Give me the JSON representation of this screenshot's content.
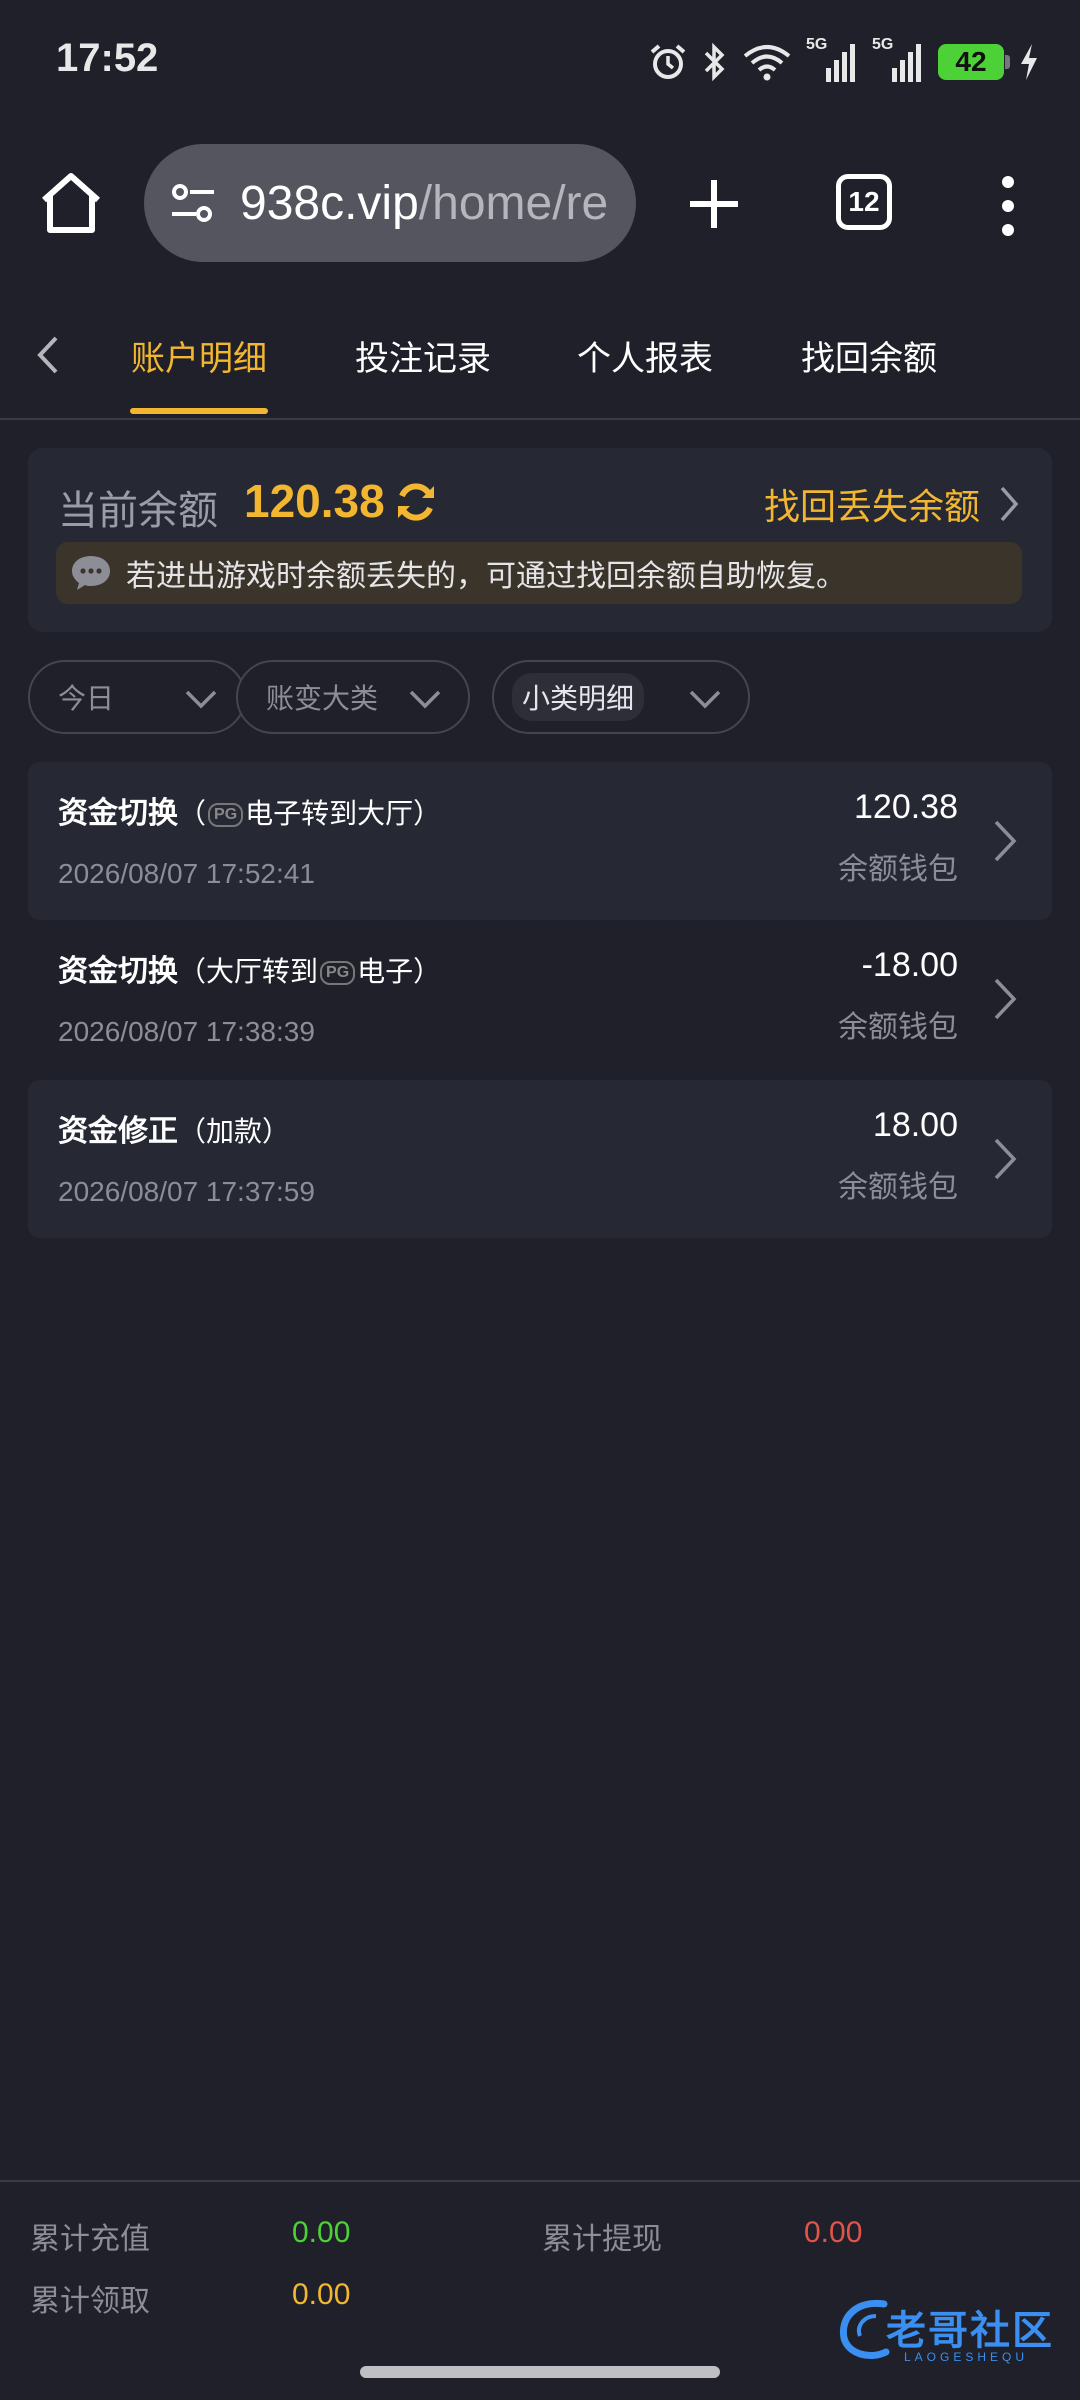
{
  "status_bar": {
    "time": "17:52",
    "battery": "42",
    "network_1": "5G",
    "network_2": "5G"
  },
  "browser": {
    "url_domain": "938c.vip",
    "url_path": "/home/re",
    "tab_count": "12"
  },
  "tabs": [
    {
      "label": "账户明细",
      "active": true
    },
    {
      "label": "投注记录",
      "active": false
    },
    {
      "label": "个人报表",
      "active": false
    },
    {
      "label": "找回余额",
      "active": false
    }
  ],
  "balance": {
    "label": "当前余额",
    "value": "120.38",
    "recover_label": "找回丢失余额",
    "notice": "若进出游戏时余额丢失的，可通过找回余额自助恢复。"
  },
  "filters": [
    {
      "label": "今日"
    },
    {
      "label": "账变大类"
    },
    {
      "label": "小类明细"
    }
  ],
  "records": [
    {
      "title": "资金切换",
      "detail_prefix": "（",
      "detail_logo": "PG",
      "detail_suffix": "电子转到大厅）",
      "time": "2026/08/07 17:52:41",
      "amount": "120.38",
      "wallet": "余额钱包"
    },
    {
      "title": "资金切换",
      "detail_prefix": "（大厅转到",
      "detail_logo": "PG",
      "detail_suffix": "电子）",
      "time": "2026/08/07 17:38:39",
      "amount": "-18.00",
      "wallet": "余额钱包"
    },
    {
      "title": "资金修正",
      "detail_prefix": "（加款）",
      "detail_logo": "",
      "detail_suffix": "",
      "time": "2026/08/07 17:37:59",
      "amount": "18.00",
      "wallet": "余额钱包"
    }
  ],
  "summary": {
    "deposit_label": "累计充值",
    "deposit_value": "0.00",
    "withdraw_label": "累计提现",
    "withdraw_value": "0.00",
    "claim_label": "累计领取",
    "claim_value": "0.00"
  },
  "watermark": {
    "text": "老哥社区",
    "sub": "LAOGESHEQU"
  },
  "colors": {
    "accent": "#f2b630",
    "background": "#1f2029",
    "card": "#262833",
    "positive": "#4cd137",
    "negative": "#e0544a"
  }
}
